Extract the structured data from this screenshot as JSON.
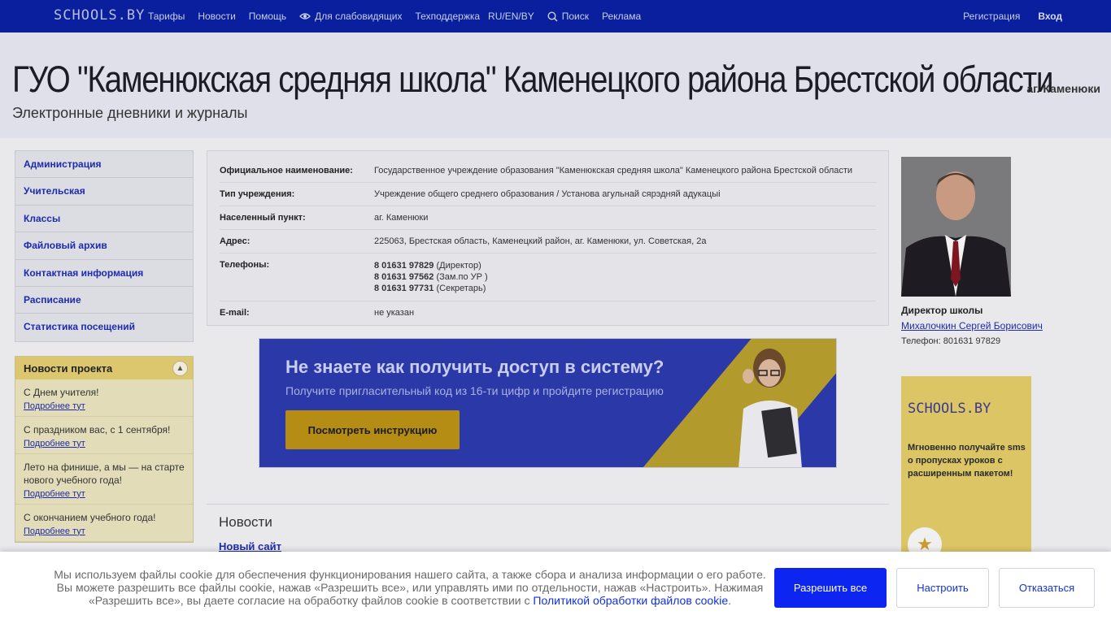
{
  "topbar": {
    "logo": "SCHOOLS.BY",
    "nav": {
      "tariffs": "Тарифы",
      "news": "Новости",
      "help": "Помощь",
      "low_vision": "Для слабовидящих",
      "support": "Техподдержка",
      "lang": "RU/EN/BY",
      "search": "Поиск",
      "ads": "Реклама"
    },
    "register": "Регистрация",
    "login": "Вход"
  },
  "header": {
    "title": "ГУО \"Каменюкская средняя школа\" Каменецкого района Брестской области",
    "village": "аг. Каменюки",
    "subtitle": "Электронные дневники и журналы"
  },
  "sidebar": {
    "menu": [
      {
        "label": "Администрация"
      },
      {
        "label": "Учительская"
      },
      {
        "label": "Классы"
      },
      {
        "label": "Файловый архив"
      },
      {
        "label": "Контактная информация"
      },
      {
        "label": "Расписание"
      },
      {
        "label": "Статистика посещений"
      }
    ],
    "news_title": "Новости проекта",
    "news": [
      {
        "title": "С Днем учителя!",
        "more": "Подробнее тут"
      },
      {
        "title": "С праздником вас, с 1 сентября!",
        "more": "Подробнее тут"
      },
      {
        "title": "Лето на финише, а мы — на старте нового учебного года!",
        "more": "Подробнее тут"
      },
      {
        "title": "С окончанием учебного года!",
        "more": "Подробнее тут"
      }
    ]
  },
  "info": {
    "official_name_label": "Официальное наименование:",
    "official_name": "Государственное учреждение образования \"Каменюкская средняя школа\" Каменецкого района Брестской области",
    "type_label": "Тип учреждения:",
    "type": "Учреждение общего среднего образования / Установа агульнай сярэдняй адукацыі",
    "locality_label": "Населенный пункт:",
    "locality": "аг. Каменюки",
    "address_label": "Адрес:",
    "address": "225063, Брестская область, Каменецкий район, аг. Каменюки, ул. Советская, 2а",
    "phones_label": "Телефоны:",
    "phones": [
      {
        "number": "8 01631 97829",
        "note": "(Директор)"
      },
      {
        "number": "8 01631 97562",
        "note": "(Зам.по УР )"
      },
      {
        "number": "8 01631 97731",
        "note": "(Секретарь)"
      }
    ],
    "email_label": "E-mail:",
    "email": "не указан"
  },
  "banner": {
    "heading": "Не знаете как получить доступ в систему?",
    "text": "Получите пригласительный код из 16-ти цифр и пройдите регистрацию",
    "button": "Посмотреть инструкцию"
  },
  "news_section": {
    "heading": "Новости",
    "first_link": "Новый сайт"
  },
  "director": {
    "role": "Директор школы",
    "name": "Михалочкин Сергей Борисович",
    "phone": "Телефон: 801631 97829"
  },
  "ad": {
    "logo": "SCHOOLS.BY",
    "text": "Мгновенно получайте sms о пропусках уроков с расширенным пакетом!"
  },
  "cookie": {
    "text": "Мы используем файлы cookie для обеспечения функционирования нашего сайта, а также сбора и анализа информации о его работе. Вы можете разрешить все файлы cookie, нажав «Разрешить все», или управлять ими по отдельности, нажав «Настроить». Нажимая «Разрешить все», вы даете согласие на обработку файлов cookie в соответствии с",
    "policy_link": "Политикой обработки файлов cookie",
    "period": ".",
    "allow": "Разрешить все",
    "settings": "Настроить",
    "refuse": "Отказаться"
  },
  "colors": {
    "topbar": "#0a1f9e",
    "link": "#1d2bb0",
    "accent_button": "#0c25f0",
    "news_header": "#dcc76e"
  }
}
